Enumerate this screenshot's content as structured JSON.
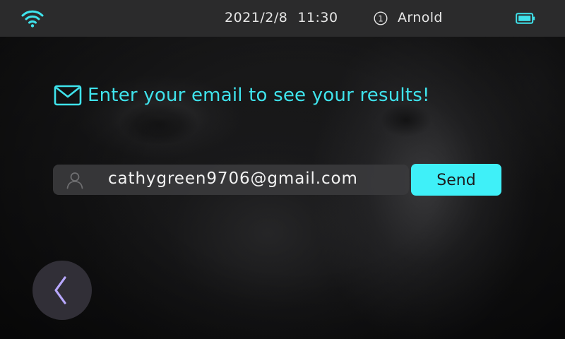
{
  "status_bar": {
    "date": "2021/2/8",
    "time": "11:30",
    "user_number": "1",
    "user_name": "Arnold",
    "icons": {
      "wifi": "wifi-icon",
      "user": "user-number-icon",
      "battery": "battery-icon"
    }
  },
  "prompt": {
    "icon": "mail-icon",
    "text": "Enter your email to see your results!"
  },
  "email_form": {
    "icon": "person-icon",
    "email_value": "cathygreen9706@gmail.com",
    "send_label": "Send"
  },
  "navigation": {
    "back_icon": "chevron-left-icon"
  },
  "colors": {
    "accent": "#3fe3ec",
    "button": "#3ff0f8",
    "status_bar": "#2b2b2c",
    "field": "#3a3a3c",
    "back_button": "#34323a",
    "back_chevron": "#b8a8ff"
  }
}
